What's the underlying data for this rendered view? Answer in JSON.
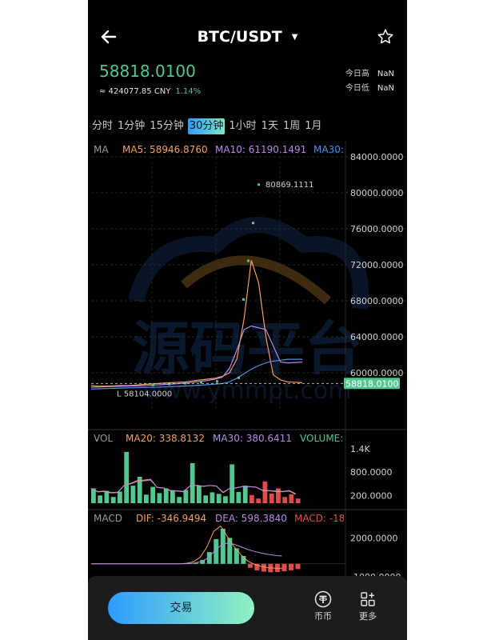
{
  "header": {
    "title": "BTC/USDT",
    "price": "58818.0100",
    "cny": "≈ 424077.85 CNY",
    "change_pct": "1.14%",
    "high_label": "今日高",
    "high_value": "NaN",
    "low_label": "今日低",
    "low_value": "NaN"
  },
  "tabs": [
    "分时",
    "1分钟",
    "15分钟",
    "30分钟",
    "1小时",
    "1天",
    "1周",
    "1月"
  ],
  "active_tab": "30分钟",
  "main_legend": {
    "ma": "MA",
    "ma5": "MA5: 58946.8760",
    "ma10": "MA10: 61190.1491",
    "ma30": "MA30:"
  },
  "vol_legend": {
    "vol": "VOL",
    "ma20": "MA20: 338.8132",
    "ma30": "MA30: 380.6411",
    "volume": "VOLUME:"
  },
  "macd_legend": {
    "macd": "MACD",
    "dif": "DIF: -346.9494",
    "dea": "DEA: 598.3840",
    "macd_val": "MACD: -18"
  },
  "annotations": {
    "high_marker": "80869.1111",
    "low_marker": "L  58104.0000",
    "last_price_tag": "58818.0100"
  },
  "watermark": {
    "main": "源码平台",
    "url": "www.ymmpt.com"
  },
  "bottom_bar": {
    "trade_label": "交易",
    "coin_label": "币币",
    "more_label": "更多"
  },
  "colors": {
    "up": "#52c790",
    "down": "#e04b4b",
    "ma5": "#f5a05a",
    "ma10": "#b58be8",
    "ma30": "#4f8fe8",
    "accent": "#2f9bff"
  },
  "chart_data": {
    "type": "line",
    "main_axis_ticks": [
      "84000.0000",
      "80000.0000",
      "76000.0000",
      "72000.0000",
      "68000.0000",
      "64000.0000",
      "60000.0000"
    ],
    "main_ylim": [
      56000,
      84000
    ],
    "main_series": [
      {
        "name": "MA5",
        "values": [
          58600,
          58500,
          58520,
          58550,
          58600,
          58580,
          58620,
          58700,
          58750,
          58800,
          58850,
          58900,
          58950,
          59000,
          59100,
          59200,
          59300,
          59400,
          59600,
          60000,
          61500,
          66000,
          72500,
          70000,
          64000,
          59800,
          59200,
          59000,
          58950,
          58900
        ]
      },
      {
        "name": "MA10",
        "values": [
          58400,
          58420,
          58450,
          58480,
          58500,
          58520,
          58540,
          58560,
          58600,
          58650,
          58700,
          58750,
          58800,
          58850,
          58950,
          59050,
          59150,
          59300,
          59500,
          60500,
          62500,
          64800,
          65200,
          65000,
          64800,
          63000,
          61200,
          61100,
          61150,
          61190
        ]
      },
      {
        "name": "MA30",
        "values": [
          58200,
          58220,
          58250,
          58280,
          58300,
          58320,
          58340,
          58360,
          58380,
          58400,
          58430,
          58460,
          58500,
          58540,
          58580,
          58620,
          58680,
          58740,
          58800,
          59000,
          59400,
          59900,
          60400,
          60800,
          61100,
          61300,
          61400,
          61500,
          61500,
          61500
        ]
      }
    ],
    "vol_axis_ticks": [
      "1.4K",
      "800.0000",
      "200.0000"
    ],
    "vol_values": [
      380,
      200,
      320,
      160,
      300,
      1320,
      450,
      680,
      220,
      420,
      260,
      380,
      330,
      160,
      340,
      1030,
      450,
      200,
      280,
      240,
      180,
      1000,
      290,
      450,
      210,
      120,
      560,
      250,
      380,
      160,
      230,
      120
    ],
    "macd_axis_ticks": [
      "2000.0000",
      "-1000.0000"
    ],
    "macd_hist": [
      0,
      0,
      0,
      0,
      0,
      0,
      0,
      0,
      0,
      0,
      0,
      0,
      0,
      0,
      20,
      80,
      300,
      900,
      1900,
      2700,
      2000,
      1200,
      600,
      -300,
      -500,
      -600,
      -650,
      -620,
      -580,
      -500,
      -400
    ],
    "macd_lines": {
      "DIF": [
        0,
        0,
        0,
        0,
        0,
        0,
        0,
        0,
        0,
        0,
        0,
        0,
        0,
        0,
        40,
        150,
        500,
        1300,
        2500,
        2900,
        2100,
        1300,
        700,
        200,
        -50,
        -200,
        -300,
        -340,
        -347
      ],
      "DEA": [
        0,
        0,
        0,
        0,
        0,
        0,
        0,
        0,
        0,
        0,
        0,
        0,
        0,
        0,
        10,
        40,
        150,
        400,
        900,
        1400,
        1600,
        1500,
        1300,
        1100,
        950,
        820,
        720,
        650,
        598
      ]
    }
  }
}
